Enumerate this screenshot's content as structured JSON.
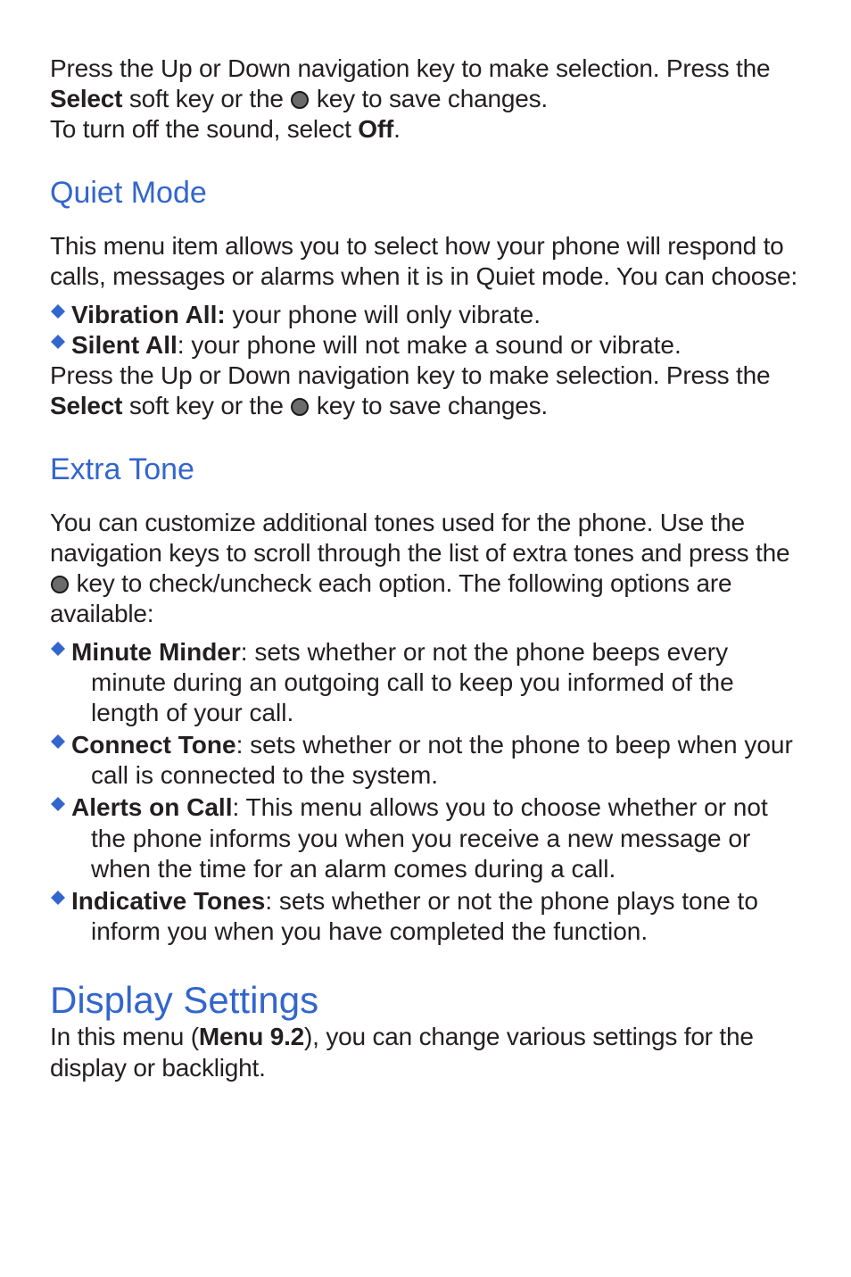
{
  "intro": {
    "line1_pre": "Press the Up or Down navigation key to make selection. Press the ",
    "select_bold": "Select",
    "line1_mid": " soft key or the ",
    "line1_post": " key to save changes.",
    "line2_pre": "To turn off the sound, select ",
    "off_bold": "Off",
    "line2_post": "."
  },
  "quiet": {
    "heading": "Quiet Mode",
    "para": "This menu item allows you to select how your phone will respond to calls, messages or alarms when it is in Quiet mode. You can choose:",
    "bullets": [
      {
        "label": "Vibration All:",
        "text": " your phone will only vibrate."
      },
      {
        "label": "Silent All",
        "text": ": your phone will not make a sound or vibrate."
      }
    ],
    "after_pre": "Press the Up or Down navigation key to make selection. Press the ",
    "after_bold": "Select",
    "after_mid": " soft key or the ",
    "after_post": " key to save changes."
  },
  "extra": {
    "heading": "Extra Tone",
    "para_pre": "You can customize additional tones used for the phone. Use the navigation keys to scroll through the list of extra tones and press the ",
    "para_post": " key to check/uncheck each option. The following options are available:",
    "bullets": [
      {
        "label": "Minute Minder",
        "text": ": sets whether or not the phone beeps every minute during an outgoing call to keep you informed of the length of your call."
      },
      {
        "label": "Connect Tone",
        "text": ": sets whether or not the phone to beep when your call is connected to the system."
      },
      {
        "label": "Alerts on Call",
        "text": ": This menu allows you to choose whether or not the phone informs you when you receive a new message or when the time for an alarm comes during a call."
      },
      {
        "label": "Indicative Tones",
        "text": ": sets whether or not the phone plays tone to inform you when you have completed the function."
      }
    ]
  },
  "display": {
    "heading": "Display Settings",
    "para_pre": "In this menu (",
    "para_bold": "Menu 9.2",
    "para_post": "), you can change various settings for the display or backlight."
  }
}
